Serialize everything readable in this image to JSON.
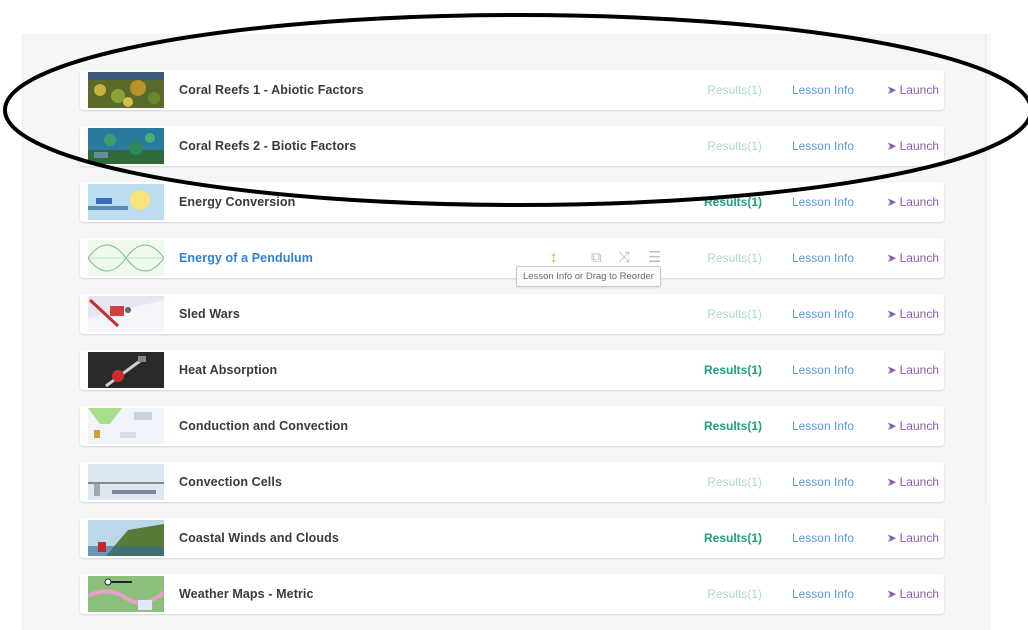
{
  "lessons": [
    {
      "title": "Coral Reefs 1 - Abiotic Factors",
      "results": "Results(1)",
      "results_active": false,
      "info": "Lesson Info",
      "launch": "Launch",
      "thumb": "coral-reef-abiotic"
    },
    {
      "title": "Coral Reefs 2 - Biotic Factors",
      "results": "Results(1)",
      "results_active": false,
      "info": "Lesson Info",
      "launch": "Launch",
      "thumb": "coral-reef-biotic"
    },
    {
      "title": "Energy Conversion",
      "results": "Results(1)",
      "results_active": true,
      "info": "Lesson Info",
      "launch": "Launch",
      "thumb": "energy-conversion"
    },
    {
      "title": "Energy of a Pendulum",
      "results": "Results(1)",
      "results_active": false,
      "info": "Lesson Info",
      "launch": "Launch",
      "thumb": "pendulum"
    },
    {
      "title": "Sled Wars",
      "results": "Results(1)",
      "results_active": false,
      "info": "Lesson Info",
      "launch": "Launch",
      "thumb": "sled"
    },
    {
      "title": "Heat Absorption",
      "results": "Results(1)",
      "results_active": true,
      "info": "Lesson Info",
      "launch": "Launch",
      "thumb": "heat-absorption"
    },
    {
      "title": "Conduction and Convection",
      "results": "Results(1)",
      "results_active": true,
      "info": "Lesson Info",
      "launch": "Launch",
      "thumb": "conduction"
    },
    {
      "title": "Convection Cells",
      "results": "Results(1)",
      "results_active": false,
      "info": "Lesson Info",
      "launch": "Launch",
      "thumb": "convection-cells"
    },
    {
      "title": "Coastal Winds and Clouds",
      "results": "Results(1)",
      "results_active": true,
      "info": "Lesson Info",
      "launch": "Launch",
      "thumb": "coastal"
    },
    {
      "title": "Weather Maps - Metric",
      "results": "Results(1)",
      "results_active": false,
      "info": "Lesson Info",
      "launch": "Launch",
      "thumb": "weather-map"
    }
  ],
  "tooltip": "Lesson Info or Drag to Reorder",
  "hovered_index": 3,
  "icons": {
    "launch": "rocket-icon",
    "sort": "sort-icon",
    "copy": "copy-icon",
    "shuffle": "shuffle-icon",
    "menu": "menu-icon"
  },
  "colors": {
    "results_active": "#1f9e7a",
    "results_inactive": "#a9dccd",
    "info": "#5b9bd5",
    "launch": "#8a5bb0",
    "link_title": "#2f7fd9",
    "annotation": "#000000"
  }
}
